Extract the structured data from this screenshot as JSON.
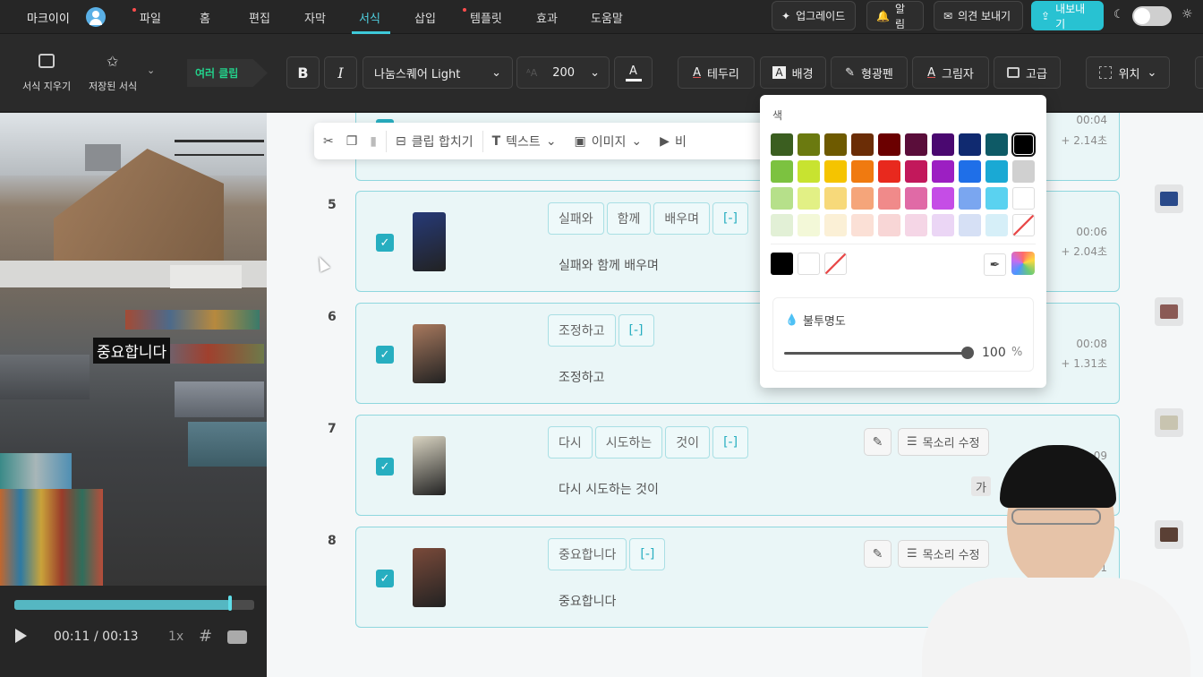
{
  "app": {
    "name": "마크이이"
  },
  "menu": [
    {
      "label": "파일",
      "dot": true
    },
    {
      "label": "홈",
      "dot": false
    },
    {
      "label": "편집",
      "dot": false
    },
    {
      "label": "자막",
      "dot": false
    },
    {
      "label": "서식",
      "dot": false,
      "active": true
    },
    {
      "label": "삽입",
      "dot": false
    },
    {
      "label": "템플릿",
      "dot": true
    },
    {
      "label": "효과",
      "dot": false
    },
    {
      "label": "도움말",
      "dot": false
    }
  ],
  "topbar": {
    "upgrade": "업그레이드",
    "alerts": "알림",
    "feedback": "의견 보내기",
    "export": "내보내기"
  },
  "toolbar": {
    "clear_format": "서식 지우기",
    "saved_format": "저장된 서식",
    "multi_clip": "여러 클립",
    "bold": "B",
    "italic": "I",
    "font": "나눔스퀘어 Light",
    "font_size": "200",
    "text_color": "A",
    "border": "테두리",
    "background": "배경",
    "highlighter": "형광펜",
    "shadow": "그림자",
    "advanced": "고급",
    "position": "위치"
  },
  "preview": {
    "caption": "중요합니다",
    "progress": 0.9,
    "current_time": "00:11",
    "total_time": "/ 00:13",
    "speed": "1x"
  },
  "floating_toolbar": {
    "merge": "클립 합치기",
    "text": "텍스트",
    "image": "이미지",
    "video": "비"
  },
  "clips": [
    {
      "num": "",
      "words": [],
      "sentence": "",
      "time": "00:04",
      "dur": "+ 2.14초",
      "thumb_color": "#caa190"
    },
    {
      "num": "5",
      "words": [
        "실패와",
        "함께",
        "배우며",
        "[-]"
      ],
      "sentence": "실패와  함께  배우며",
      "time": "00:06",
      "dur": "+ 2.04초",
      "thumb_color": "#263a78"
    },
    {
      "num": "6",
      "words": [
        "조정하고",
        "[-]"
      ],
      "sentence": "조정하고",
      "time": "00:08",
      "dur": "+ 1.31초",
      "thumb_color": "#a8795e"
    },
    {
      "num": "7",
      "words": [
        "다시",
        "시도하는",
        "것이",
        "[-]"
      ],
      "sentence": "다시  시도하는  것이",
      "time": "09",
      "dur": "",
      "thumb_color": "#d9d4c2",
      "voice": "목소리 수정",
      "ga": "가"
    },
    {
      "num": "8",
      "words": [
        "중요합니다",
        "[-]"
      ],
      "sentence": "중요합니다",
      "time": "11",
      "dur": "",
      "thumb_color": "#7a4a3a",
      "voice": "목소리 수정"
    }
  ],
  "color_panel": {
    "title": "색",
    "rows": [
      [
        "#3b5e20",
        "#6b7a10",
        "#6e5a00",
        "#6b2d06",
        "#6b0000",
        "#5a0d3a",
        "#4a0870",
        "#102a70",
        "#0e5a66",
        "#000000"
      ],
      [
        "#7cc240",
        "#c8e330",
        "#f5c400",
        "#f07a10",
        "#e8291e",
        "#c2185b",
        "#9c1fc2",
        "#1f6fe8",
        "#1aa9d4",
        "#d0d0d0"
      ],
      [
        "#b6e08a",
        "#e2f085",
        "#f7d97a",
        "#f5a57a",
        "#f08a8a",
        "#e06aa6",
        "#c54de6",
        "#7aa6f0",
        "#5ad2f0",
        "#ffffff"
      ],
      [
        "#e2f0d6",
        "#f3f8d8",
        "#fbf0d6",
        "#fbe0d6",
        "#f8d6d6",
        "#f5d6e6",
        "#ebd6f5",
        "#d6e0f5",
        "#d6eff8",
        "none"
      ]
    ],
    "extra": [
      "#000000",
      "#ffffff",
      "none"
    ],
    "opacity_label": "불투명도",
    "opacity_value": "100",
    "opacity_unit": "%",
    "opacity_level": 1.0
  }
}
